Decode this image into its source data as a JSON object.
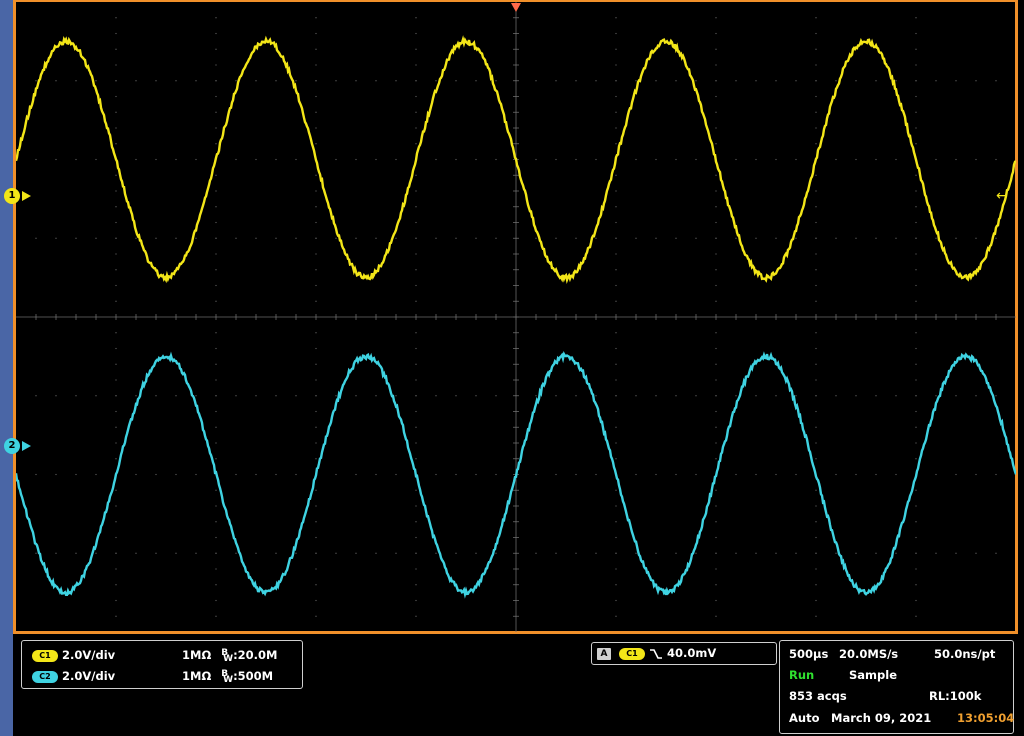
{
  "channels": [
    {
      "badge": "C1",
      "scale": "2.0V/div",
      "impedance": "1MΩ",
      "bw_prefix": "B",
      "bw_sub": "W",
      "bw_value": ":20.0M",
      "color": "#f3e618"
    },
    {
      "badge": "C2",
      "scale": "2.0V/div",
      "impedance": "1MΩ",
      "bw_prefix": "B",
      "bw_sub": "W",
      "bw_value": ":500M",
      "color": "#3fd3e2"
    }
  ],
  "markers": {
    "ch1": "1",
    "ch2": "2"
  },
  "trigger": {
    "mode_icon": "A",
    "source": "C1",
    "slope_icon": "falling-edge-icon",
    "level": "40.0mV"
  },
  "acquisition": {
    "timebase": "500μs",
    "sample_rate": "20.0MS/s",
    "resolution": "50.0ns/pt",
    "state": "Run",
    "mode": "Sample",
    "acqs": "853 acqs",
    "record_length": "RL:100k",
    "trigger_mode": "Auto",
    "date": "March 09, 2021",
    "time": "13:05:04"
  },
  "display": {
    "grid_divisions": {
      "horizontal": 10,
      "vertical": 8
    },
    "frame_color": "#f0902a",
    "background_color": "#000000"
  },
  "waveforms": [
    {
      "channel": "C1",
      "color": "#f3e618",
      "cycles_on_screen": 5,
      "amplitude_divisions": 1.5,
      "offset_divisions": 2.0,
      "phase": "rising at left edge"
    },
    {
      "channel": "C2",
      "color": "#3fd3e2",
      "cycles_on_screen": 5,
      "amplitude_divisions": 1.5,
      "offset_divisions": -2.0,
      "phase": "falling at left edge"
    }
  ]
}
